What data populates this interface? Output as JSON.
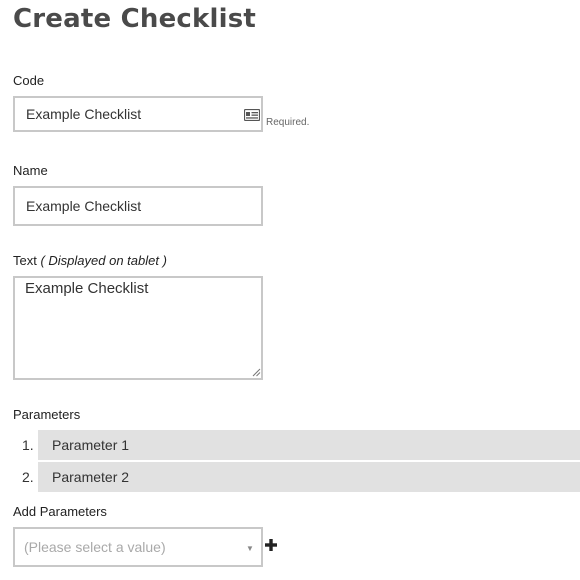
{
  "page": {
    "title": "Create Checklist"
  },
  "code": {
    "label": "Code",
    "value": "Example Checklist",
    "icon": "id-card-icon",
    "required_note": "Required."
  },
  "name": {
    "label": "Name",
    "value": "Example Checklist"
  },
  "text": {
    "label": "Text",
    "label_note": "( Displayed on tablet )",
    "value": "Example Checklist"
  },
  "parameters": {
    "label": "Parameters",
    "items": [
      {
        "number": "1.",
        "label": "Parameter 1"
      },
      {
        "number": "2.",
        "label": "Parameter 2"
      }
    ]
  },
  "add_parameters": {
    "label": "Add Parameters",
    "placeholder": "(Please select a value)",
    "add_icon": "plus-icon"
  }
}
